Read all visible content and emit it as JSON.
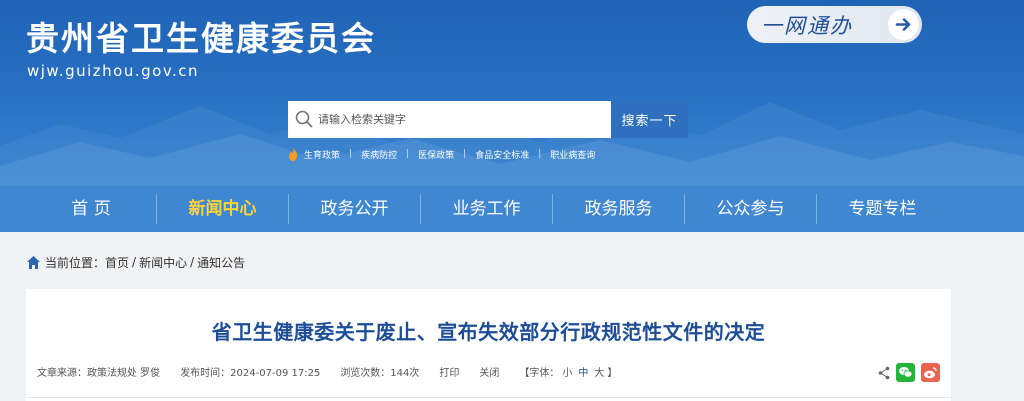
{
  "header": {
    "site_title": "贵州省卫生健康委员会",
    "site_domain": "wjw.guizhou.gov.cn",
    "one_net_label": "一网通办"
  },
  "search": {
    "placeholder": "请输入检索关键字",
    "button_label": "搜索一下"
  },
  "hot_links": [
    "生育政策",
    "疾病防控",
    "医保政策",
    "食品安全标准",
    "职业病查询"
  ],
  "nav": {
    "items": [
      "首 页",
      "新闻中心",
      "政务公开",
      "业务工作",
      "政务服务",
      "公众参与",
      "专题专栏"
    ],
    "active_index": 1
  },
  "breadcrumb": {
    "label": "当前位置：",
    "items": [
      "首页",
      "新闻中心",
      "通知公告"
    ],
    "separator": "/"
  },
  "article": {
    "title": "省卫生健康委关于废止、宣布失效部分行政规范性文件的决定",
    "source": "文章来源：政策法规处 罗俊",
    "published": "发布时间：2024-07-09 17:25",
    "views": "浏览次数：144次",
    "print_label": "打印",
    "close_label": "关闭",
    "font_prefix": "【字体：",
    "font_small": "小",
    "font_medium": "中",
    "font_large": "大",
    "font_suffix": "】"
  },
  "colors": {
    "header_blue": "#1f63b5",
    "nav_blue": "#3f87d0",
    "nav_active": "#ffd23a",
    "title_blue": "#1c4d96",
    "wechat_green": "#25b43a",
    "weibo_red": "#e9654f"
  },
  "icons": [
    "search-icon",
    "flame-icon",
    "arrow-right-icon",
    "home-icon",
    "share-icon",
    "wechat-icon",
    "weibo-icon"
  ]
}
